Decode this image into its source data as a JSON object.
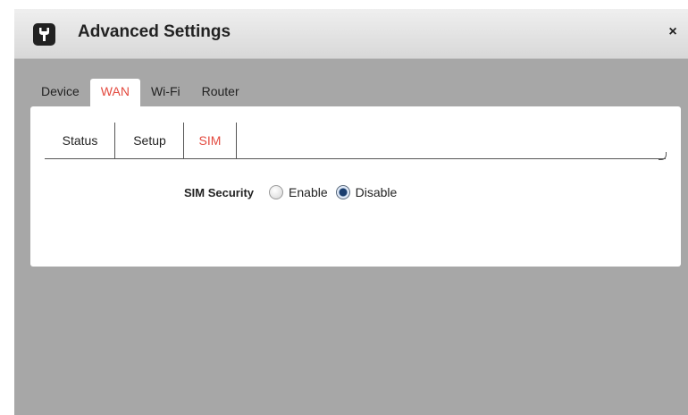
{
  "window": {
    "title": "Advanced Settings",
    "close_label": "×"
  },
  "main_tabs": [
    {
      "label": "Device",
      "active": false
    },
    {
      "label": "WAN",
      "active": true
    },
    {
      "label": "Wi-Fi",
      "active": false
    },
    {
      "label": "Router",
      "active": false
    }
  ],
  "sub_tabs": [
    {
      "label": "Status",
      "active": false
    },
    {
      "label": "Setup",
      "active": false
    },
    {
      "label": "SIM",
      "active": true
    }
  ],
  "sim_security": {
    "label": "SIM Security",
    "options": [
      {
        "label": "Enable",
        "selected": false
      },
      {
        "label": "Disable",
        "selected": true
      }
    ]
  },
  "colors": {
    "accent": "#e34a3f",
    "backdrop": "#a7a7a7"
  },
  "icons": {
    "app": "wrench-icon"
  }
}
